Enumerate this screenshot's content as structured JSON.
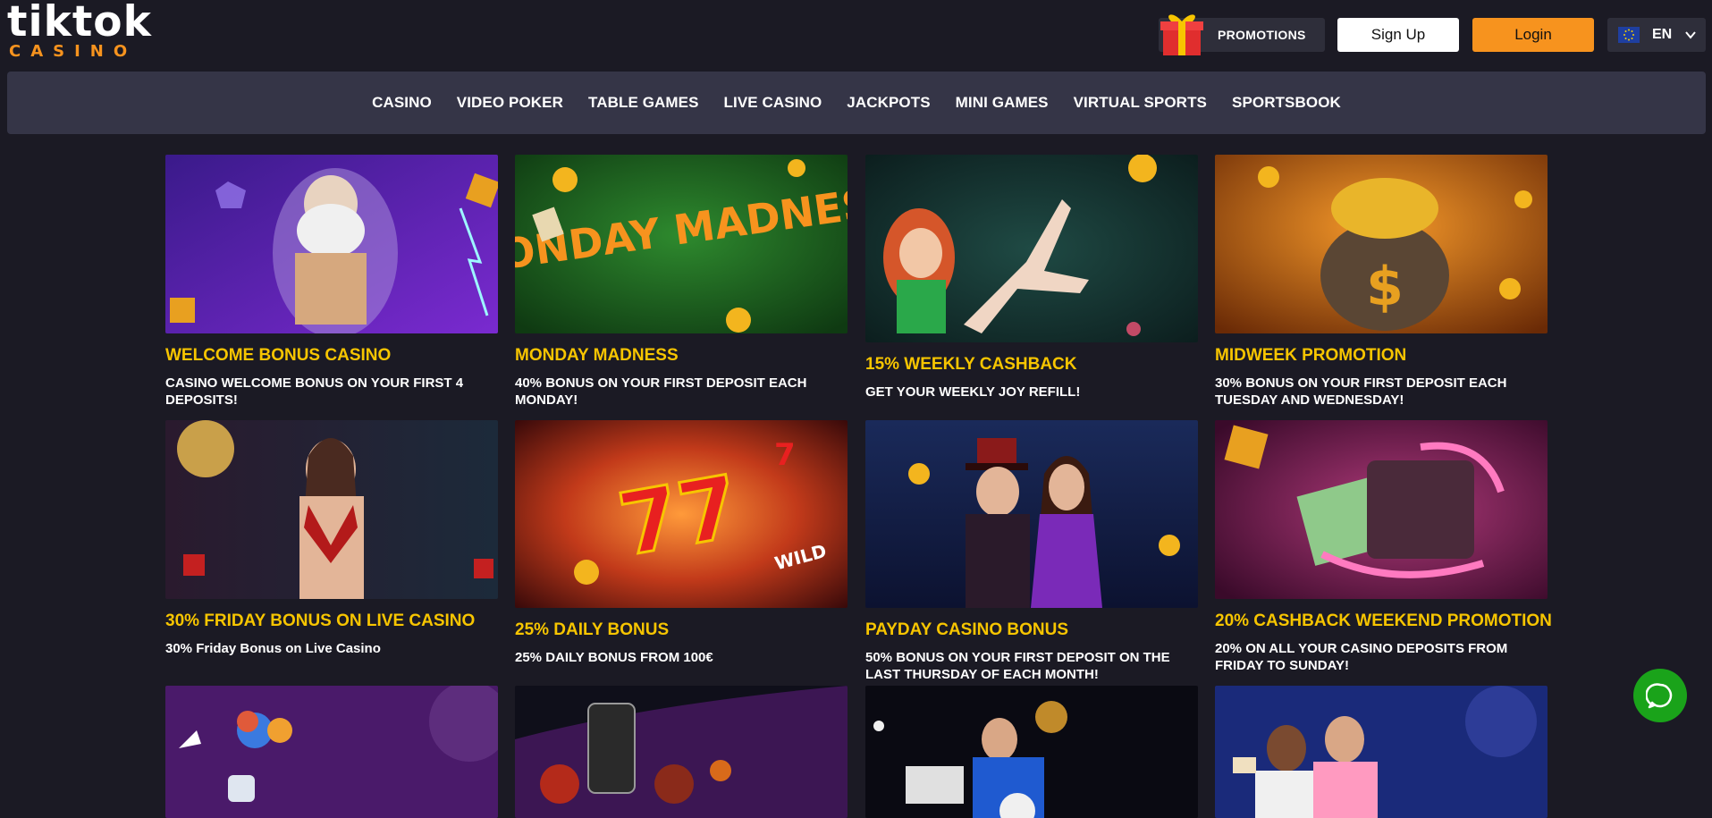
{
  "brand": {
    "logo_top": "tiktok",
    "logo_bottom": "CASINO"
  },
  "header": {
    "promotions_label": "PROMOTIONS",
    "signup_label": "Sign Up",
    "login_label": "Login",
    "language": "EN",
    "accent_color": "#f7931e"
  },
  "nav": {
    "items": [
      {
        "label": "CASINO"
      },
      {
        "label": "VIDEO POKER"
      },
      {
        "label": "TABLE GAMES"
      },
      {
        "label": "LIVE CASINO"
      },
      {
        "label": "JACKPOTS"
      },
      {
        "label": "MINI GAMES"
      },
      {
        "label": "VIRTUAL SPORTS"
      },
      {
        "label": "SPORTSBOOK"
      }
    ]
  },
  "promotions": [
    {
      "title": "WELCOME BONUS CASINO",
      "desc": "CASINO WELCOME BONUS ON YOUR FIRST 4 DEPOSITS!"
    },
    {
      "title": "MONDAY MADNESS",
      "desc": "40% BONUS ON YOUR FIRST DEPOSIT EACH MONDAY!",
      "banner_text": "MONDAY MADNESS"
    },
    {
      "title": "15% WEEKLY CASHBACK",
      "desc": "GET YOUR WEEKLY JOY REFILL!"
    },
    {
      "title": "MIDWEEK PROMOTION",
      "desc": "30% BONUS ON YOUR FIRST DEPOSIT EACH TUESDAY AND WEDNESDAY!"
    },
    {
      "title": "30% FRIDAY BONUS ON LIVE CASINO",
      "desc": "30% Friday Bonus on Live Casino"
    },
    {
      "title": "25% DAILY BONUS",
      "desc": "25% DAILY BONUS FROM 100€",
      "banner_text": "WILD"
    },
    {
      "title": "PAYDAY CASINO BONUS",
      "desc": "50% BONUS ON YOUR FIRST DEPOSIT ON THE LAST THURSDAY OF EACH MONTH!"
    },
    {
      "title": "20% CASHBACK WEEKEND PROMOTION",
      "desc": "20% ON ALL YOUR CASINO DEPOSITS FROM FRIDAY TO SUNDAY!"
    },
    {
      "title": "",
      "desc": ""
    },
    {
      "title": "",
      "desc": ""
    },
    {
      "title": "",
      "desc": ""
    },
    {
      "title": "",
      "desc": ""
    }
  ],
  "colors": {
    "background": "#1b1a24",
    "nav_bg": "#353547",
    "title_yellow": "#f7c500",
    "chat_green": "#1aa31a"
  },
  "icons": [
    "gift-icon",
    "eu-flag-icon",
    "chevron-down-icon",
    "chat-bubble-icon"
  ]
}
